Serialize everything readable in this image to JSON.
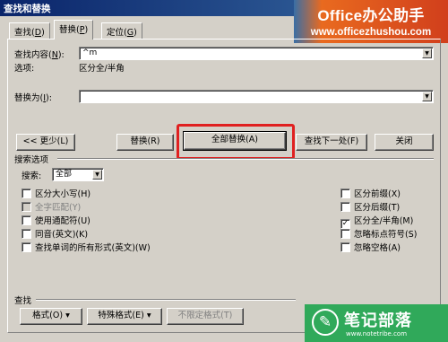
{
  "window": {
    "title": "查找和替换"
  },
  "brand": {
    "title": "Office办公助手",
    "url": "www.officezhushou.com"
  },
  "tabs": [
    {
      "label": "查找",
      "key": "D"
    },
    {
      "label": "替换",
      "key": "P"
    },
    {
      "label": "定位",
      "key": "G"
    }
  ],
  "find": {
    "label": "查找内容",
    "key": "N",
    "value": "^m"
  },
  "options": {
    "label": "选项:",
    "value": "区分全/半角"
  },
  "replace": {
    "label": "替换为",
    "key": "I",
    "value": ""
  },
  "buttons": {
    "less": "<< 更少(L)",
    "replace": "替换(R)",
    "replace_all": "全部替换(A)",
    "find_next": "查找下一处(F)",
    "close": "关闭"
  },
  "search_options": {
    "title": "搜索选项",
    "search_label": "搜索:",
    "search_value": "全部",
    "left": [
      {
        "label": "区分大小写(H)",
        "checked": false,
        "enabled": true
      },
      {
        "label": "全字匹配(Y)",
        "checked": false,
        "enabled": false
      },
      {
        "label": "使用通配符(U)",
        "checked": false,
        "enabled": true
      },
      {
        "label": "同音(英文)(K)",
        "checked": false,
        "enabled": true
      },
      {
        "label": "查找单词的所有形式(英文)(W)",
        "checked": false,
        "enabled": true
      }
    ],
    "right": [
      {
        "label": "区分前缀(X)",
        "checked": false,
        "enabled": true
      },
      {
        "label": "区分后缀(T)",
        "checked": false,
        "enabled": true
      },
      {
        "label": "区分全/半角(M)",
        "checked": true,
        "enabled": true
      },
      {
        "label": "忽略标点符号(S)",
        "checked": false,
        "enabled": true
      },
      {
        "label": "忽略空格(A)",
        "checked": false,
        "enabled": true
      }
    ]
  },
  "find_section": {
    "title": "查找",
    "format_button": "格式(O) ▾",
    "special_button": "特殊格式(E) ▾",
    "no_format_button": "不限定格式(T)"
  },
  "watermark": {
    "title": "笔记部落",
    "url": "www.notetribe.com"
  },
  "colors": {
    "highlight": "#e02020",
    "titlebar": "#0a246a",
    "watermark": "#30a95a"
  }
}
